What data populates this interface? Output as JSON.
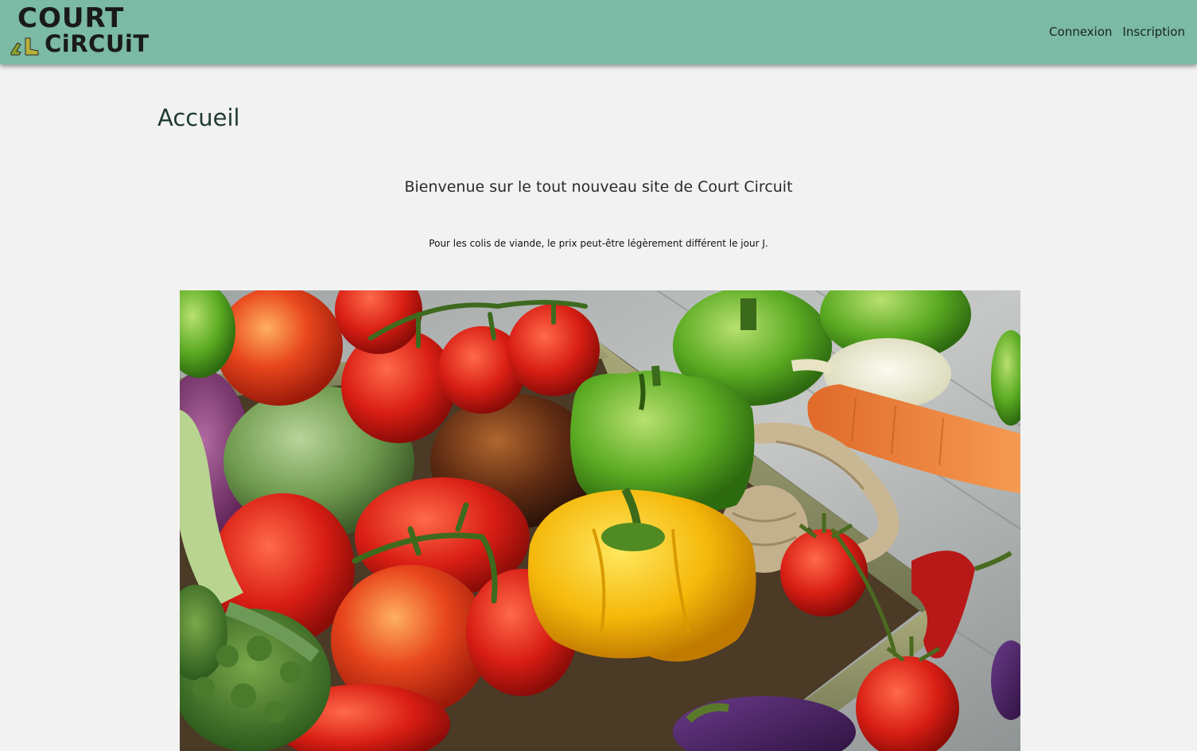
{
  "header": {
    "logo": {
      "line1": "COURT",
      "line2": "CiRCUiT",
      "alt_name": "Court Circuit"
    },
    "nav": [
      {
        "label": "Connexion"
      },
      {
        "label": "Inscription"
      }
    ],
    "background_color": "#7bbaa4"
  },
  "main": {
    "title": "Accueil",
    "welcome_text": "Bienvenue sur le tout nouveau site de Court Circuit",
    "notice_text": "Pour les colis de viande, le prix peut-être légèrement différent le jour J.",
    "hero_image": {
      "icon": "vegetables-crate-photo"
    }
  }
}
